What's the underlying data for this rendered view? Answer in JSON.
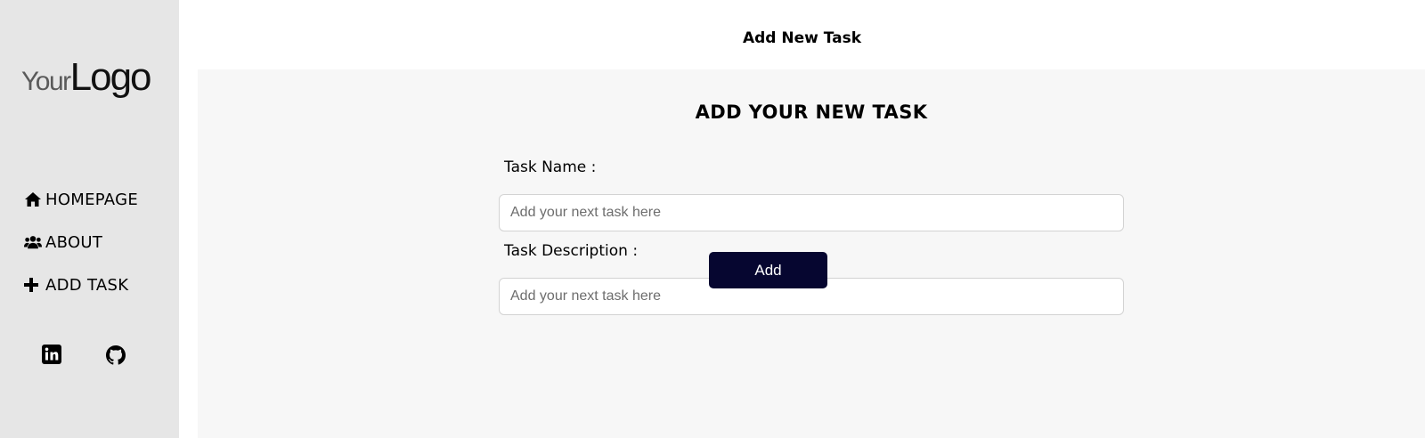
{
  "sidebar": {
    "logo": {
      "your": "Your",
      "logo": "Logo"
    },
    "nav": [
      {
        "label": "HOMEPAGE",
        "icon": "home-icon"
      },
      {
        "label": "ABOUT",
        "icon": "users-icon"
      },
      {
        "label": "ADD TASK",
        "icon": "plus-icon"
      }
    ],
    "social": [
      {
        "icon": "linkedin-icon"
      },
      {
        "icon": "github-icon"
      }
    ]
  },
  "main": {
    "page_title": "Add New Task",
    "panel_heading": "ADD YOUR NEW TASK",
    "form": {
      "task_name_label": "Task Name :",
      "task_name_placeholder": "Add your next task here",
      "task_name_value": "",
      "task_description_label": "Task Description :",
      "task_description_placeholder": "Add your next task here",
      "task_description_value": "",
      "submit_label": "Add"
    }
  },
  "colors": {
    "sidebar_bg": "#e6e6e6",
    "panel_bg": "#f7f7f7",
    "button_bg": "#060630",
    "button_text": "#ffffff"
  }
}
